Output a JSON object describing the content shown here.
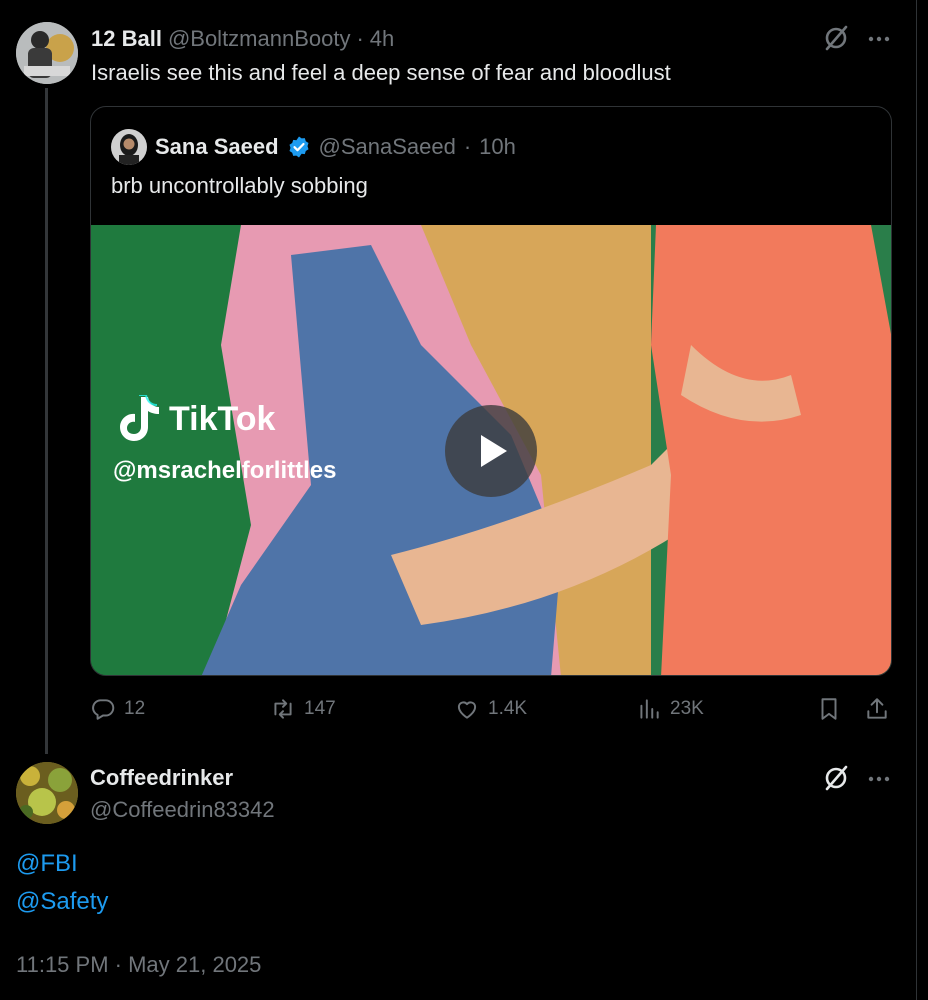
{
  "post": {
    "display_name": "12 Ball",
    "handle": "@BoltzmannBooty",
    "separator": "·",
    "time": "4h",
    "text": "Israelis see this and feel a deep sense of fear and bloodlust"
  },
  "quote": {
    "display_name": "Sana Saeed",
    "handle": "@SanaSaeed",
    "separator": "·",
    "time": "10h",
    "text": "brb uncontrollably sobbing",
    "media": {
      "watermark_brand": "TikTok",
      "watermark_handle": "@msrachelforlittles"
    }
  },
  "actions": {
    "replies": "12",
    "reposts": "147",
    "likes": "1.4K",
    "views": "23K"
  },
  "reply": {
    "display_name": "Coffeedrinker",
    "handle": "@Coffeedrin83342",
    "mentions": [
      "@FBI",
      "@Safety"
    ],
    "timestamp": "11:15 PM · May 21, 2025"
  },
  "colors": {
    "background": "#000000",
    "text": "#e7e9ea",
    "muted": "#71767b",
    "link": "#1d9bf0",
    "border": "#2f3336"
  },
  "icons": {
    "reply": "speech-bubble-icon",
    "repost": "repost-icon",
    "like": "heart-icon",
    "views": "bar-chart-icon",
    "bookmark": "bookmark-icon",
    "share": "share-icon",
    "grok": "grok-icon",
    "more": "more-icon",
    "verified": "verified-badge-icon",
    "play": "play-icon"
  }
}
